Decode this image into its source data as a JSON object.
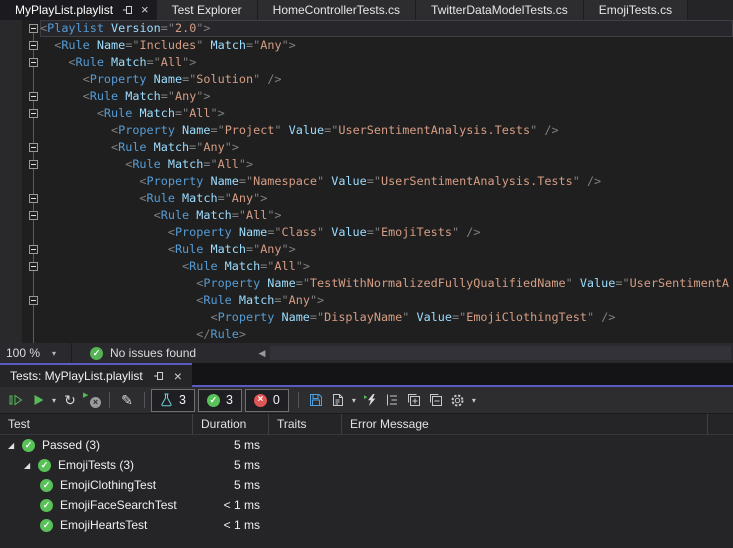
{
  "document_tabs": [
    {
      "label": "MyPlayList.playlist",
      "active": true
    },
    {
      "label": "Test Explorer",
      "active": false
    },
    {
      "label": "HomeControllerTests.cs",
      "active": false
    },
    {
      "label": "TwitterDataModelTests.cs",
      "active": false
    },
    {
      "label": "EmojiTests.cs",
      "active": false
    }
  ],
  "editor": {
    "language": "xml",
    "lines": [
      {
        "indent": 0,
        "fold": "box",
        "current": true,
        "text": "<Playlist Version=\"2.0\">"
      },
      {
        "indent": 1,
        "fold": "box",
        "text": "<Rule Name=\"Includes\" Match=\"Any\">"
      },
      {
        "indent": 2,
        "fold": "box",
        "text": "<Rule Match=\"All\">"
      },
      {
        "indent": 3,
        "fold": "line",
        "text": "<Property Name=\"Solution\" />"
      },
      {
        "indent": 3,
        "fold": "box",
        "text": "<Rule Match=\"Any\">"
      },
      {
        "indent": 4,
        "fold": "box",
        "text": "<Rule Match=\"All\">"
      },
      {
        "indent": 5,
        "fold": "line",
        "text": "<Property Name=\"Project\" Value=\"UserSentimentAnalysis.Tests\" />"
      },
      {
        "indent": 5,
        "fold": "box",
        "text": "<Rule Match=\"Any\">"
      },
      {
        "indent": 6,
        "fold": "box",
        "text": "<Rule Match=\"All\">"
      },
      {
        "indent": 7,
        "fold": "line",
        "text": "<Property Name=\"Namespace\" Value=\"UserSentimentAnalysis.Tests\" />"
      },
      {
        "indent": 7,
        "fold": "box",
        "text": "<Rule Match=\"Any\">"
      },
      {
        "indent": 8,
        "fold": "box",
        "text": "<Rule Match=\"All\">"
      },
      {
        "indent": 9,
        "fold": "line",
        "text": "<Property Name=\"Class\" Value=\"EmojiTests\" />"
      },
      {
        "indent": 9,
        "fold": "box",
        "text": "<Rule Match=\"Any\">"
      },
      {
        "indent": 10,
        "fold": "box",
        "text": "<Rule Match=\"All\">"
      },
      {
        "indent": 11,
        "fold": "line",
        "text": "<Property Name=\"TestWithNormalizedFullyQualifiedName\" Value=\"UserSentimentA"
      },
      {
        "indent": 11,
        "fold": "box",
        "text": "<Rule Match=\"Any\">"
      },
      {
        "indent": 12,
        "fold": "line",
        "text": "<Property Name=\"DisplayName\" Value=\"EmojiClothingTest\" />"
      },
      {
        "indent": 11,
        "fold": "line",
        "text": "</Rule>"
      }
    ]
  },
  "editor_status": {
    "zoom_level": "100 %",
    "health_message": "No issues found"
  },
  "panel": {
    "tab_label": "Tests: MyPlayList.playlist",
    "toolbar": {
      "total_count": "3",
      "passed_count": "3",
      "failed_count": "0"
    },
    "table": {
      "columns": [
        "Test",
        "Duration",
        "Traits",
        "Error Message"
      ],
      "rows": [
        {
          "level": 0,
          "expanded": true,
          "status": "passed",
          "label": "Passed (3)",
          "duration": "5 ms",
          "traits": "",
          "error": ""
        },
        {
          "level": 1,
          "expanded": true,
          "status": "passed",
          "label": "EmojiTests (3)",
          "duration": "5 ms",
          "traits": "",
          "error": ""
        },
        {
          "level": 2,
          "expanded": false,
          "status": "passed",
          "label": "EmojiClothingTest",
          "duration": "5 ms",
          "traits": "",
          "error": ""
        },
        {
          "level": 2,
          "expanded": false,
          "status": "passed",
          "label": "EmojiFaceSearchTest",
          "duration": "< 1 ms",
          "traits": "",
          "error": ""
        },
        {
          "level": 2,
          "expanded": false,
          "status": "passed",
          "label": "EmojiHeartsTest",
          "duration": "< 1 ms",
          "traits": "",
          "error": ""
        }
      ]
    }
  },
  "icons": {
    "close": "×",
    "dropdown_caret": "▾",
    "repeat_run": "↻",
    "edit_pencil": "✎",
    "check": "✓",
    "fail_x": "×",
    "expanded_arrow": "◢",
    "scroll_left": "◀"
  },
  "colors": {
    "accent_purple": "#5d59c2",
    "xml_element": "#569cd6",
    "xml_attribute": "#9cdcfe",
    "xml_value": "#d69d85",
    "xml_delimiter": "#808080",
    "pass_green": "#58c158",
    "fail_red": "#e05555",
    "flask_cyan": "#6fd3d3",
    "save_blue": "#4f9ede",
    "run_green": "#57b957"
  }
}
